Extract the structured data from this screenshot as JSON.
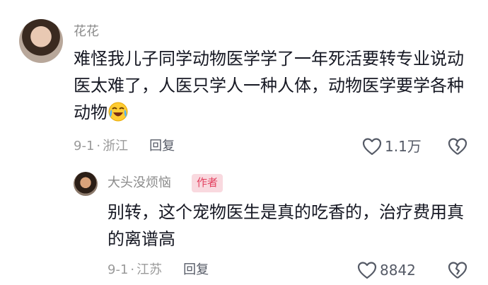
{
  "comments": [
    {
      "username": "花花",
      "text": "难怪我儿子同学动物医学学了一年死活要转专业说动医太难了，人医只学人一种人体，动物医学要学各种动物",
      "emoji": "crying-laughing-emoji",
      "date": "9-1",
      "location": "浙江",
      "reply_label": "回复",
      "likes": "1.1万"
    }
  ],
  "replies": [
    {
      "username": "大头没烦恼",
      "badge": "作者",
      "text": "别转，这个宠物医生是真的吃香的，治疗费用真的离谱高",
      "date": "9-1",
      "location": "江苏",
      "reply_label": "回复",
      "likes": "8842"
    }
  ],
  "meta_separator": "·",
  "colors": {
    "text": "#161823",
    "meta": "#9a9a9a",
    "author_badge_bg": "#f9d9df",
    "author_badge_text": "#e3405f"
  },
  "icons": [
    "heart-outline-icon",
    "broken-heart-icon"
  ]
}
